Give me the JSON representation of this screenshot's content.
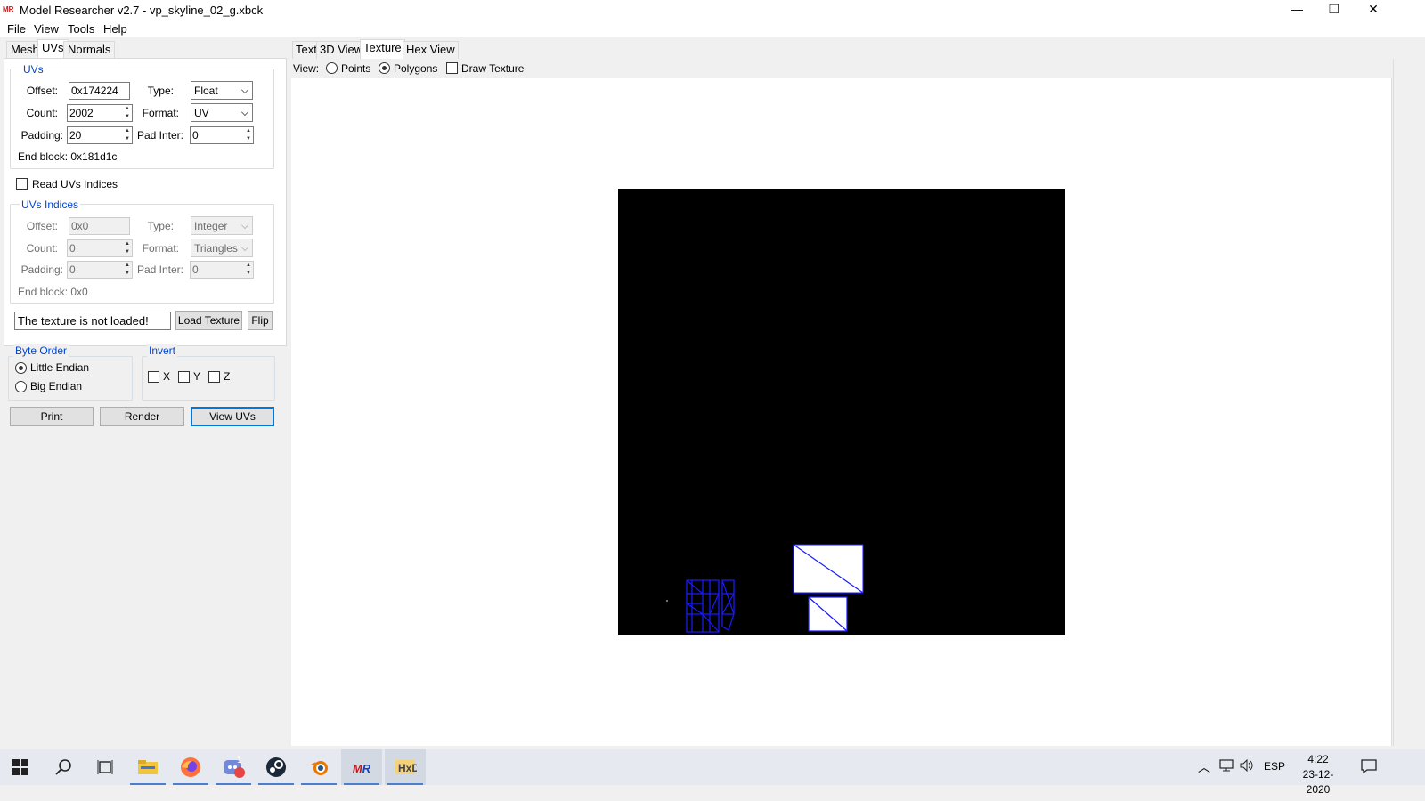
{
  "window": {
    "app_icon": "MR",
    "title": "Model Researcher v2.7 - vp_skyline_02_g.xbck",
    "minimize": "—",
    "restore": "❐",
    "close": "✕"
  },
  "menu": [
    "File",
    "View",
    "Tools",
    "Help"
  ],
  "left_tabs": [
    "Mesh",
    "UVs",
    "Normals"
  ],
  "uvs_group": {
    "title": "UVs",
    "offset_label": "Offset:",
    "offset_value": "0x174224",
    "type_label": "Type:",
    "type_value": "Float",
    "count_label": "Count:",
    "count_value": "2002",
    "format_label": "Format:",
    "format_value": "UV",
    "padding_label": "Padding:",
    "padding_value": "20",
    "pad_inter_label": "Pad Inter:",
    "pad_inter_value": "0",
    "end_block": "End block: 0x181d1c"
  },
  "read_uv_indices_label": "Read UVs Indices",
  "uv_indices_group": {
    "title": "UVs Indices",
    "offset_label": "Offset:",
    "offset_value": "0x0",
    "type_label": "Type:",
    "type_value": "Integer",
    "count_label": "Count:",
    "count_value": "0",
    "format_label": "Format:",
    "format_value": "Triangles",
    "padding_label": "Padding:",
    "padding_value": "0",
    "pad_inter_label": "Pad Inter:",
    "pad_inter_value": "0",
    "end_block": "End block: 0x0"
  },
  "texture_status": "The texture is not loaded!",
  "load_texture_button": "Load Texture",
  "flip_button": "Flip",
  "byte_order": {
    "title": "Byte Order",
    "little": "Little Endian",
    "big": "Big Endian",
    "selected": "Little Endian"
  },
  "invert": {
    "title": "Invert",
    "x": "X",
    "y": "Y",
    "z": "Z"
  },
  "actions": {
    "print": "Print",
    "render": "Render",
    "view_uvs": "View UVs"
  },
  "right_tabs": [
    "Text",
    "3D View",
    "Texture",
    "Hex View"
  ],
  "view_bar": {
    "label": "View:",
    "points": "Points",
    "polygons": "Polygons",
    "draw_texture": "Draw Texture",
    "selected": "Polygons"
  },
  "uv_line_color": "#1a1aff",
  "taskbar": {
    "apps": [
      "windows-start-icon",
      "search-icon",
      "task-view-icon",
      "file-explorer-icon",
      "firefox-icon",
      "discord-icon",
      "steam-icon",
      "blender-icon",
      "model-researcher-icon",
      "hex-editor-icon"
    ],
    "discord_badge": "1",
    "language": "ESP",
    "time": "4:22",
    "date": "23-12-2020"
  }
}
